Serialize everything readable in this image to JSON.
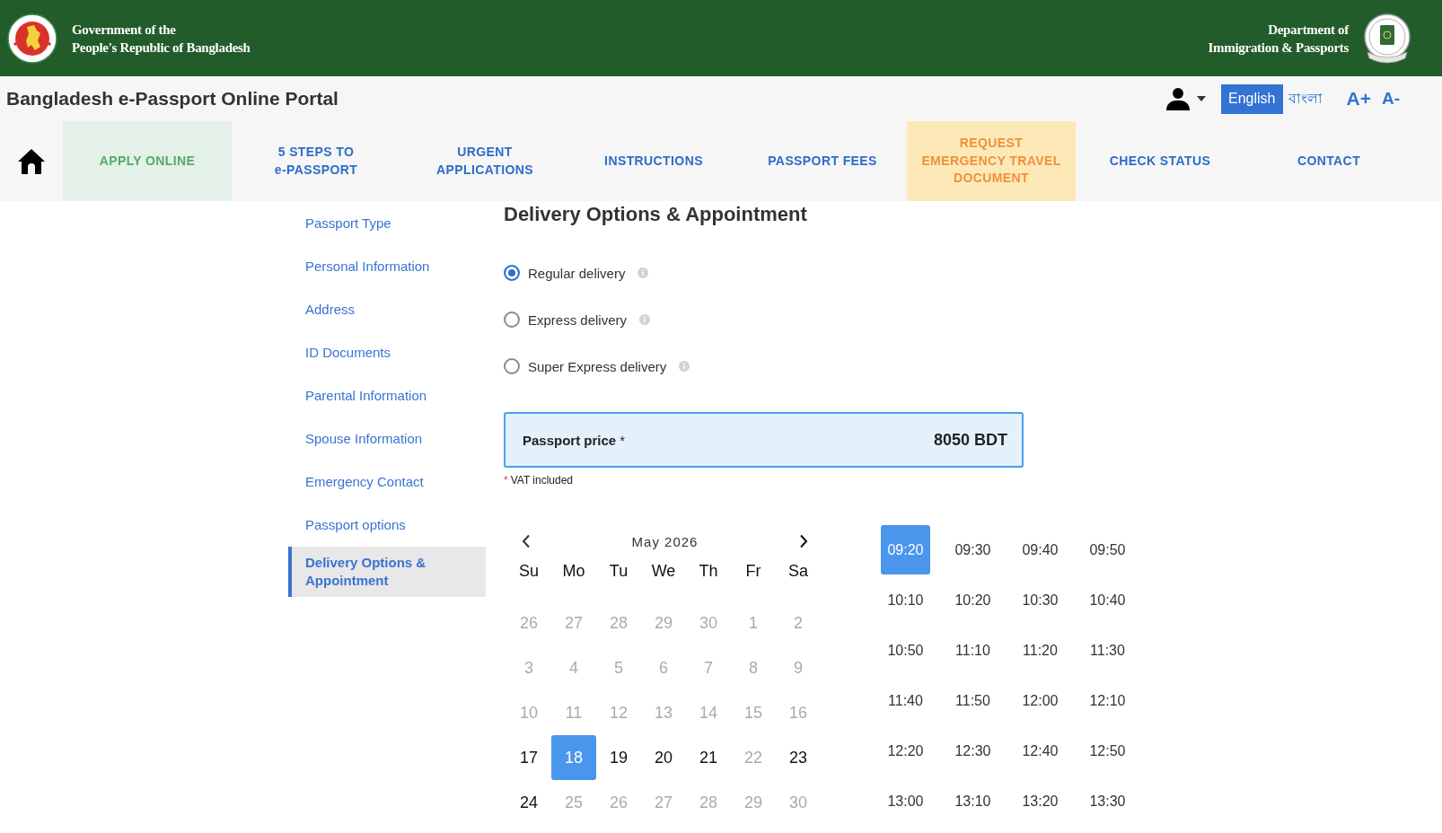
{
  "header": {
    "left_title": "Government of the\nPeople's Republic of Bangladesh",
    "right_title": "Department of\nImmigration & Passports"
  },
  "title_bar": {
    "title": "Bangladesh e-Passport Online Portal",
    "languages": [
      {
        "label": "English",
        "selected": true
      },
      {
        "label": "বাংলা",
        "selected": false
      }
    ],
    "font_size_controls": [
      "A+",
      "A-"
    ]
  },
  "nav": {
    "items": [
      {
        "label": "APPLY ONLINE",
        "kind": "link",
        "selected": true
      },
      {
        "label": "5 STEPS TO\ne-PASSPORT",
        "kind": "link",
        "selected": false
      },
      {
        "label": "URGENT\nAPPLICATIONS",
        "kind": "link",
        "selected": false
      },
      {
        "label": "INSTRUCTIONS",
        "kind": "link",
        "selected": false
      },
      {
        "label": "PASSPORT FEES",
        "kind": "link",
        "selected": false
      },
      {
        "label": "REQUEST\nEMERGENCY TRAVEL\nDOCUMENT",
        "kind": "alert",
        "selected": false
      },
      {
        "label": "CHECK STATUS",
        "kind": "link",
        "selected": false
      },
      {
        "label": "CONTACT",
        "kind": "link",
        "selected": false
      }
    ]
  },
  "sidebar": {
    "items": [
      {
        "label": "Passport Type",
        "selected": false
      },
      {
        "label": "Personal Information",
        "selected": false
      },
      {
        "label": "Address",
        "selected": false
      },
      {
        "label": "ID Documents",
        "selected": false
      },
      {
        "label": "Parental Information",
        "selected": false
      },
      {
        "label": "Spouse Information",
        "selected": false
      },
      {
        "label": "Emergency Contact",
        "selected": false
      },
      {
        "label": "Passport options",
        "selected": false
      },
      {
        "label": "Delivery Options & Appointment",
        "selected": true
      }
    ]
  },
  "content": {
    "title": "Delivery Options & Appointment",
    "delivery_options": [
      {
        "label": "Regular delivery",
        "selected": true
      },
      {
        "label": "Express delivery",
        "selected": false
      },
      {
        "label": "Super Express delivery",
        "selected": false
      }
    ],
    "price": {
      "label": "Passport price",
      "required_mark": "*",
      "value": "8050 BDT"
    },
    "vat_note": {
      "mark": "*",
      "text": "VAT included"
    },
    "calendar": {
      "month": "May 2026",
      "weekdays": [
        "Su",
        "Mo",
        "Tu",
        "We",
        "Th",
        "Fr",
        "Sa"
      ],
      "days": [
        {
          "label": "26",
          "available": false,
          "selected": false
        },
        {
          "label": "27",
          "available": false,
          "selected": false
        },
        {
          "label": "28",
          "available": false,
          "selected": false
        },
        {
          "label": "29",
          "available": false,
          "selected": false
        },
        {
          "label": "30",
          "available": false,
          "selected": false
        },
        {
          "label": "1",
          "available": false,
          "selected": false
        },
        {
          "label": "2",
          "available": false,
          "selected": false
        },
        {
          "label": "3",
          "available": false,
          "selected": false
        },
        {
          "label": "4",
          "available": false,
          "selected": false
        },
        {
          "label": "5",
          "available": false,
          "selected": false
        },
        {
          "label": "6",
          "available": false,
          "selected": false
        },
        {
          "label": "7",
          "available": false,
          "selected": false
        },
        {
          "label": "8",
          "available": false,
          "selected": false
        },
        {
          "label": "9",
          "available": false,
          "selected": false
        },
        {
          "label": "10",
          "available": false,
          "selected": false
        },
        {
          "label": "11",
          "available": false,
          "selected": false
        },
        {
          "label": "12",
          "available": false,
          "selected": false
        },
        {
          "label": "13",
          "available": false,
          "selected": false
        },
        {
          "label": "14",
          "available": false,
          "selected": false
        },
        {
          "label": "15",
          "available": false,
          "selected": false
        },
        {
          "label": "16",
          "available": false,
          "selected": false
        },
        {
          "label": "17",
          "available": true,
          "selected": false
        },
        {
          "label": "18",
          "available": true,
          "selected": true
        },
        {
          "label": "19",
          "available": true,
          "selected": false
        },
        {
          "label": "20",
          "available": true,
          "selected": false
        },
        {
          "label": "21",
          "available": true,
          "selected": false
        },
        {
          "label": "22",
          "available": false,
          "selected": false
        },
        {
          "label": "23",
          "available": true,
          "selected": false
        },
        {
          "label": "24",
          "available": true,
          "selected": false
        },
        {
          "label": "25",
          "available": false,
          "selected": false
        },
        {
          "label": "26",
          "available": false,
          "selected": false
        },
        {
          "label": "27",
          "available": false,
          "selected": false
        },
        {
          "label": "28",
          "available": false,
          "selected": false
        },
        {
          "label": "29",
          "available": false,
          "selected": false
        },
        {
          "label": "30",
          "available": false,
          "selected": false
        }
      ]
    },
    "time_slots": [
      {
        "label": "09:20",
        "selected": true
      },
      {
        "label": "09:30",
        "selected": false
      },
      {
        "label": "09:40",
        "selected": false
      },
      {
        "label": "09:50",
        "selected": false
      },
      {
        "label": "10:10",
        "selected": false
      },
      {
        "label": "10:20",
        "selected": false
      },
      {
        "label": "10:30",
        "selected": false
      },
      {
        "label": "10:40",
        "selected": false
      },
      {
        "label": "10:50",
        "selected": false
      },
      {
        "label": "11:10",
        "selected": false
      },
      {
        "label": "11:20",
        "selected": false
      },
      {
        "label": "11:30",
        "selected": false
      },
      {
        "label": "11:40",
        "selected": false
      },
      {
        "label": "11:50",
        "selected": false
      },
      {
        "label": "12:00",
        "selected": false
      },
      {
        "label": "12:10",
        "selected": false
      },
      {
        "label": "12:20",
        "selected": false
      },
      {
        "label": "12:30",
        "selected": false
      },
      {
        "label": "12:40",
        "selected": false
      },
      {
        "label": "12:50",
        "selected": false
      },
      {
        "label": "13:00",
        "selected": false
      },
      {
        "label": "13:10",
        "selected": false
      },
      {
        "label": "13:20",
        "selected": false
      },
      {
        "label": "13:30",
        "selected": false
      }
    ]
  }
}
